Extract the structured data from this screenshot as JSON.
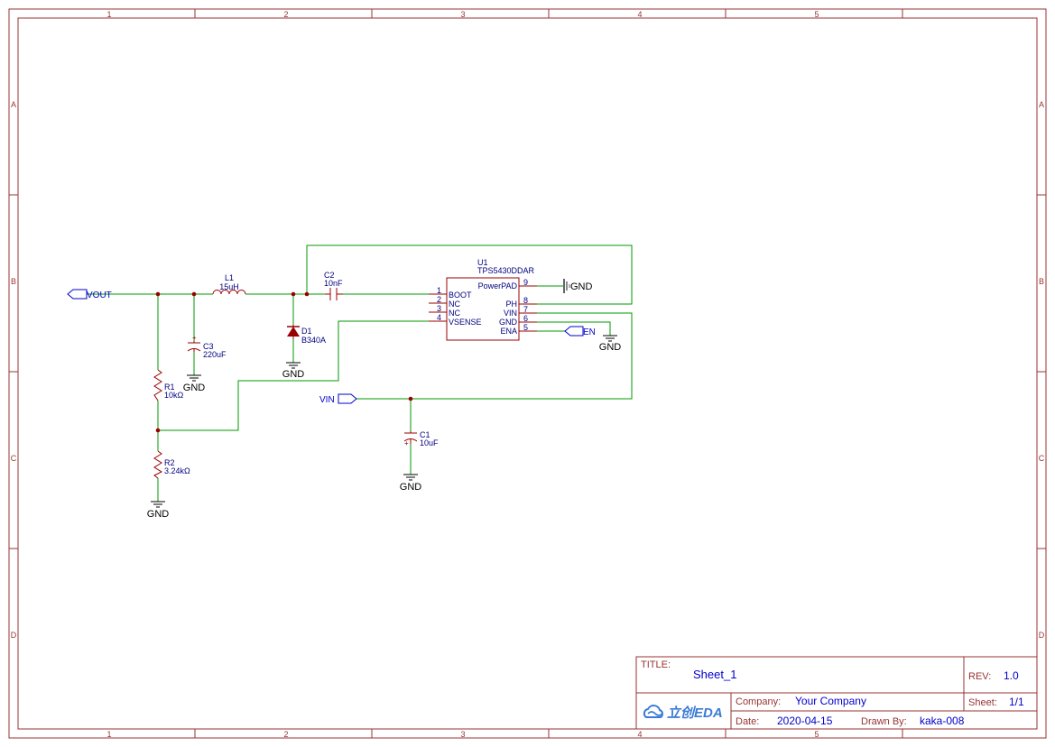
{
  "frame": {
    "columns": [
      "1",
      "2",
      "3",
      "4",
      "5"
    ],
    "rows": [
      "A",
      "B",
      "C",
      "D"
    ],
    "border_color": "#993333"
  },
  "colors": {
    "wire": "#009900",
    "part": "#990000",
    "text_blue": "#0000cc",
    "net_blue": "#0000cc",
    "ic_text": "#000080",
    "gnd_black": "#000000",
    "powerpad_gnd": "#666666"
  },
  "components": {
    "l1": {
      "ref": "L1",
      "value": "15uH"
    },
    "c2": {
      "ref": "C2",
      "value": "10nF"
    },
    "c3": {
      "ref": "C3",
      "value": "220uF",
      "polarity": "+"
    },
    "c1": {
      "ref": "C1",
      "value": "10uF",
      "polarity": "+"
    },
    "d1": {
      "ref": "D1",
      "value": "B340A"
    },
    "r1": {
      "ref": "R1",
      "value": "10kΩ"
    },
    "r2": {
      "ref": "R2",
      "value": "3.24kΩ"
    },
    "u1": {
      "ref": "U1",
      "value": "TPS5430DDAR",
      "left_pins": [
        {
          "num": "1",
          "name": "BOOT"
        },
        {
          "num": "2",
          "name": "NC"
        },
        {
          "num": "3",
          "name": "NC"
        },
        {
          "num": "4",
          "name": "VSENSE"
        }
      ],
      "right_pins": [
        {
          "num": "9",
          "name": "PowerPAD"
        },
        {
          "num": "8",
          "name": "PH"
        },
        {
          "num": "7",
          "name": "VIN"
        },
        {
          "num": "6",
          "name": "GND"
        },
        {
          "num": "5",
          "name": "ENA"
        }
      ]
    }
  },
  "nets": {
    "vout": "VOUT",
    "vin": "VIN",
    "en": "EN",
    "gnd": "GND"
  },
  "title_block": {
    "title_label": "TITLE:",
    "title_value": "Sheet_1",
    "rev_label": "REV:",
    "rev_value": "1.0",
    "company_label": "Company:",
    "company_value": "Your Company",
    "sheet_label": "Sheet:",
    "sheet_value": "1/1",
    "date_label": "Date:",
    "date_value": "2020-04-15",
    "drawn_label": "Drawn By:",
    "drawn_value": "kaka-008",
    "logo_text": "立创EDA"
  }
}
